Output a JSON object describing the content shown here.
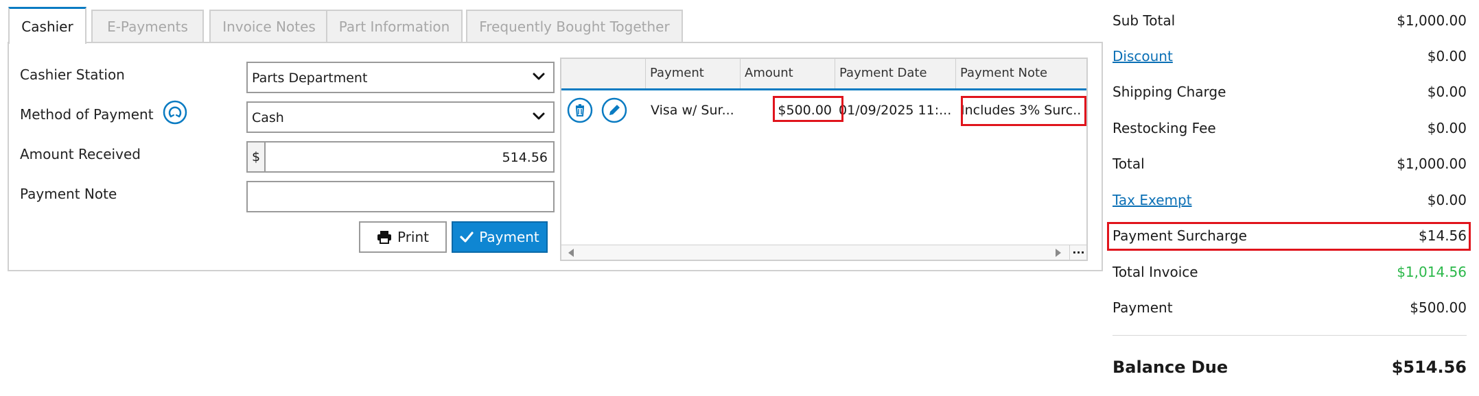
{
  "tabs": [
    "Cashier",
    "E-Payments",
    "Invoice Notes",
    "Part Information",
    "Frequently Bought Together"
  ],
  "form": {
    "cashier_station_label": "Cashier Station",
    "cashier_station_value": "Parts Department",
    "method_label": "Method of Payment",
    "method_value": "Cash",
    "amount_label": "Amount Received",
    "amount_prefix": "$",
    "amount_value": "514.56",
    "note_label": "Payment Note",
    "note_value": "",
    "print_label": "Print",
    "payment_label": "Payment"
  },
  "grid": {
    "columns": [
      "Payment",
      "Amount",
      "Payment Date",
      "Payment Note"
    ],
    "rows": [
      {
        "payment": "Visa w/ Sur...",
        "amount": "$500.00",
        "date": "01/09/2025 11:...",
        "note": "Includes 3% Surc..."
      }
    ],
    "more": "..."
  },
  "summary": [
    {
      "label": "Sub Total",
      "amount": "$1,000.00",
      "link": false
    },
    {
      "label": "Discount",
      "amount": "$0.00",
      "link": true
    },
    {
      "label": "Shipping Charge",
      "amount": "$0.00",
      "link": false
    },
    {
      "label": "Restocking Fee",
      "amount": "$0.00",
      "link": false
    },
    {
      "label": "Total",
      "amount": "$1,000.00",
      "link": false
    },
    {
      "label": "Tax Exempt",
      "amount": "$0.00",
      "link": true
    },
    {
      "label": "Payment Surcharge",
      "amount": "$14.56",
      "link": false
    },
    {
      "label": "Total Invoice",
      "amount": "$1,014.56",
      "link": false
    },
    {
      "label": "Payment",
      "amount": "$500.00",
      "link": false
    }
  ],
  "balance": {
    "label": "Balance Due",
    "amount": "$514.56"
  },
  "colors": {
    "accent": "#0a7bc2",
    "button": "#0f86d2",
    "highlight": "#e0141c",
    "green": "#2bb84a",
    "link": "#0a6fb5"
  }
}
